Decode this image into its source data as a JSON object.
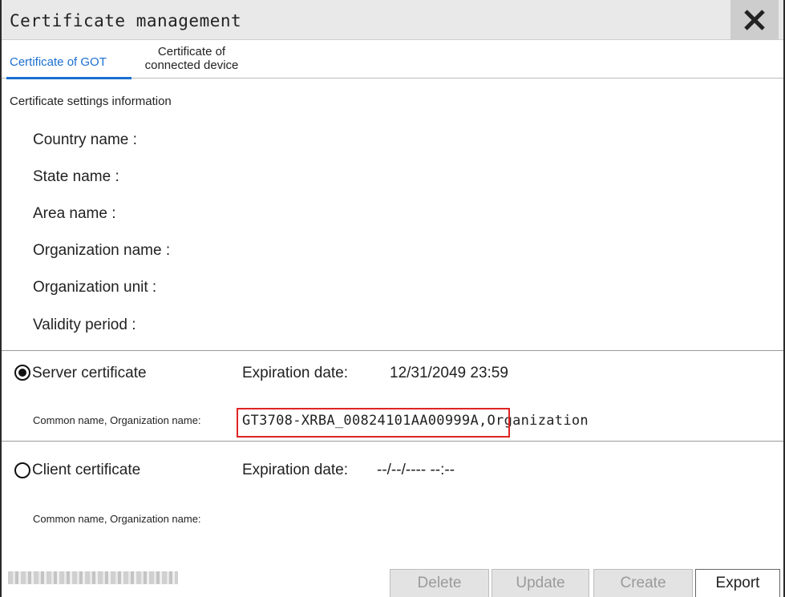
{
  "window": {
    "title": "Certificate management",
    "close_icon": "close-icon"
  },
  "tabs": [
    {
      "label": "Certificate of GOT",
      "active": true
    },
    {
      "label_line1": "Certificate of",
      "label_line2": "connected device",
      "active": false
    }
  ],
  "info": {
    "section_label": "Certificate settings information",
    "fields": [
      "Country name :",
      "State name :",
      "Area name :",
      "Organization name :",
      "Organization unit :",
      "Validity period :"
    ]
  },
  "server": {
    "label": "Server certificate",
    "selected": true,
    "expiration_label": "Expiration date:",
    "expiration_value": "12/31/2049 23:59",
    "cn_label": "Common name, Organization name:",
    "cn_value": "GT3708-XRBA_00824101AA00999A,Organization"
  },
  "client": {
    "label": "Client certificate",
    "selected": false,
    "expiration_label": "Expiration date:",
    "expiration_value": "--/--/---- --:--",
    "cn_label": "Common name, Organization name:"
  },
  "buttons": {
    "delete": "Delete",
    "update": "Update",
    "create": "Create",
    "export": "Export"
  },
  "colors": {
    "accent": "#1b6fd1",
    "highlight": "#e02424",
    "disabled_text": "#9a9a9a"
  }
}
